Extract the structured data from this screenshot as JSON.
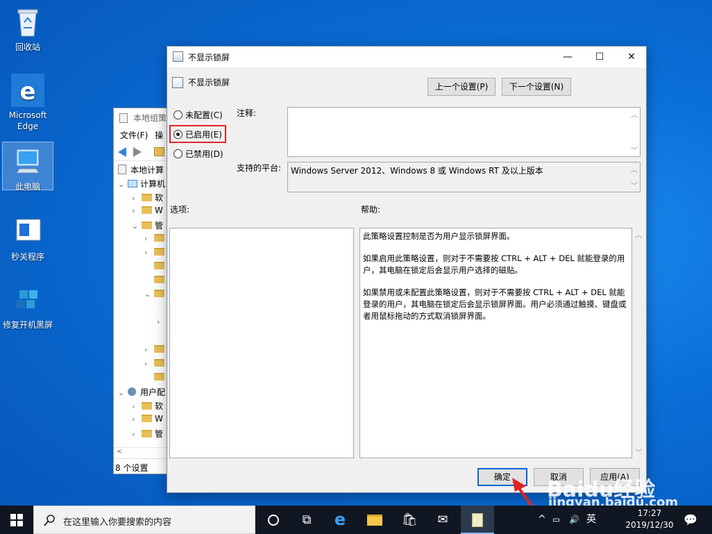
{
  "desktop": {
    "icons": [
      {
        "label": "回收站"
      },
      {
        "label": "Microsoft\nEdge"
      },
      {
        "label": "此电脑"
      },
      {
        "label": "秒关程序"
      },
      {
        "label": "修复开机黑屏"
      }
    ]
  },
  "gpedit": {
    "title": "本地组策",
    "menu": [
      "文件(F)",
      "操"
    ],
    "tree": {
      "root": "本地计算",
      "computer": "计算机",
      "n1": "软",
      "n2": "W",
      "n3": "管",
      "user": "用户配",
      "u1": "软",
      "u2": "W",
      "u3": "管"
    },
    "status": "8 个设置"
  },
  "dialog": {
    "title": "不显示锁屏",
    "setting_name": "不显示锁屏",
    "prev_button": "上一个设置(P)",
    "next_button": "下一个设置(N)",
    "radios": {
      "not_configured": "未配置(C)",
      "enabled": "已启用(E)",
      "disabled": "已禁用(D)",
      "selected": "enabled"
    },
    "comment_label": "注释:",
    "comment_value": "",
    "platform_label": "支持的平台:",
    "platform_value": "Windows Server 2012、Windows 8 或 Windows RT 及以上版本",
    "options_label": "选项:",
    "help_label": "帮助:",
    "help_paragraphs": [
      "此策略设置控制是否为用户显示锁屏界面。",
      "如果启用此策略设置，则对于不需要按 CTRL + ALT + DEL 就能登录的用户，其电脑在锁定后会显示用户选择的磁贴。",
      "如果禁用或未配置此策略设置，则对于不需要按 CTRL + ALT + DEL 就能登录的用户，其电脑在锁定后会显示锁屏界面。用户必须通过触摸、键盘或者用鼠标拖动的方式取消锁屏界面。"
    ],
    "ok_button": "确定",
    "cancel_button": "取消",
    "apply_button": "应用(A)"
  },
  "taskbar": {
    "search_placeholder": "在这里输入你要搜索的内容",
    "ime": "英",
    "clock_time": "17:27",
    "clock_date": "2019/12/30"
  },
  "watermark": {
    "brand": "Baidu经验",
    "url": "jingyan.baidu.com"
  },
  "colors": {
    "desktop": "#0a6fd8",
    "taskbar": "#101722",
    "highlight_box": "#e02424",
    "annotation_arrow": "#e02424",
    "primary_button_border": "#0a64d6"
  }
}
